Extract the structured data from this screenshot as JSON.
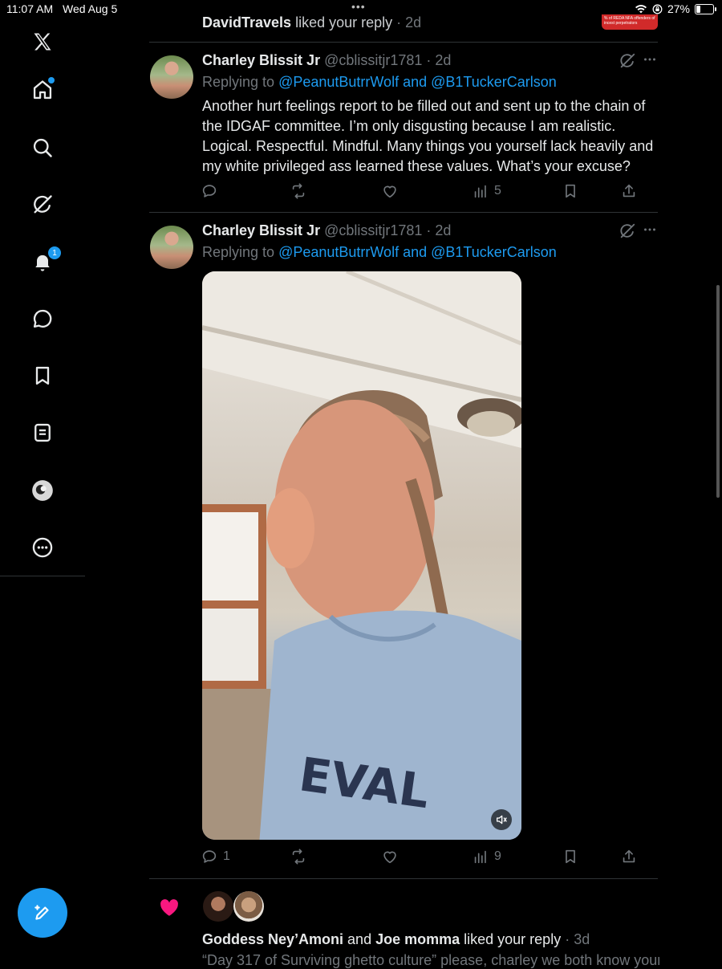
{
  "status_bar": {
    "time": "11:07 AM",
    "date": "Wed Aug 5",
    "multitask_dots": "•••",
    "battery": "27%",
    "battery_level": 0.27
  },
  "sidebar": {
    "items": [
      {
        "name": "x-logo",
        "icon": "x-logo-icon"
      },
      {
        "name": "home",
        "icon": "home-icon",
        "has_dot": true
      },
      {
        "name": "explore",
        "icon": "search-icon"
      },
      {
        "name": "grok",
        "icon": "grok-icon"
      },
      {
        "name": "notifications",
        "icon": "bell-icon",
        "badge": "1"
      },
      {
        "name": "messages",
        "icon": "message-icon"
      },
      {
        "name": "bookmarks",
        "icon": "bookmark-icon"
      },
      {
        "name": "lists",
        "icon": "list-icon"
      },
      {
        "name": "profile",
        "icon": "profile-avatar-icon"
      },
      {
        "name": "more",
        "icon": "more-circle-icon"
      }
    ],
    "compose_icon": "compose-icon"
  },
  "top_notification": {
    "user": "DavidTravels",
    "action": " liked your reply",
    "time": " · 2d",
    "thumb_text": "% of REDA NFA offenders of incest perpetrators"
  },
  "tweets": [
    {
      "name": "Charley Blissit Jr",
      "handle": " @cblissitjr1781",
      "time": " · 2d",
      "replying_prefix": "Replying to ",
      "replying_to_1": "@PeanutButrrWolf",
      "replying_and": " and ",
      "replying_to_2": "@B1TuckerCarlson",
      "text": "Another hurt feelings report to be filled out and sent up to the chain of the IDGAF committee. I’m only disgusting because I am realistic. Logical. Respectful. Mindful. Many things you yourself lack heavily and my white privileged ass learned these values. What’s your excuse?",
      "replies": "",
      "retweets": "",
      "likes": "",
      "views": "5"
    },
    {
      "name": "Charley Blissit Jr",
      "handle": " @cblissitjr1781",
      "time": " · 2d",
      "replying_prefix": "Replying to ",
      "replying_to_1": "@PeanutButrrWolf",
      "replying_and": " and ",
      "replying_to_2": "@B1TuckerCarlson",
      "media": "video",
      "replies": "1",
      "retweets": "",
      "likes": "",
      "views": "9"
    }
  ],
  "like_notification": {
    "user1": "Goddess Ney’Amoni",
    "and": " and ",
    "user2": "Joe momma",
    "action": " liked your reply",
    "time": " · 3d",
    "quote": "“Day 317 of Surviving ghetto culture” please, charley we both know your"
  },
  "colors": {
    "accent": "#1d9bf0",
    "like_pink": "#f91880",
    "muted": "#71767b",
    "text": "#e7e9ea",
    "background": "#000000"
  }
}
